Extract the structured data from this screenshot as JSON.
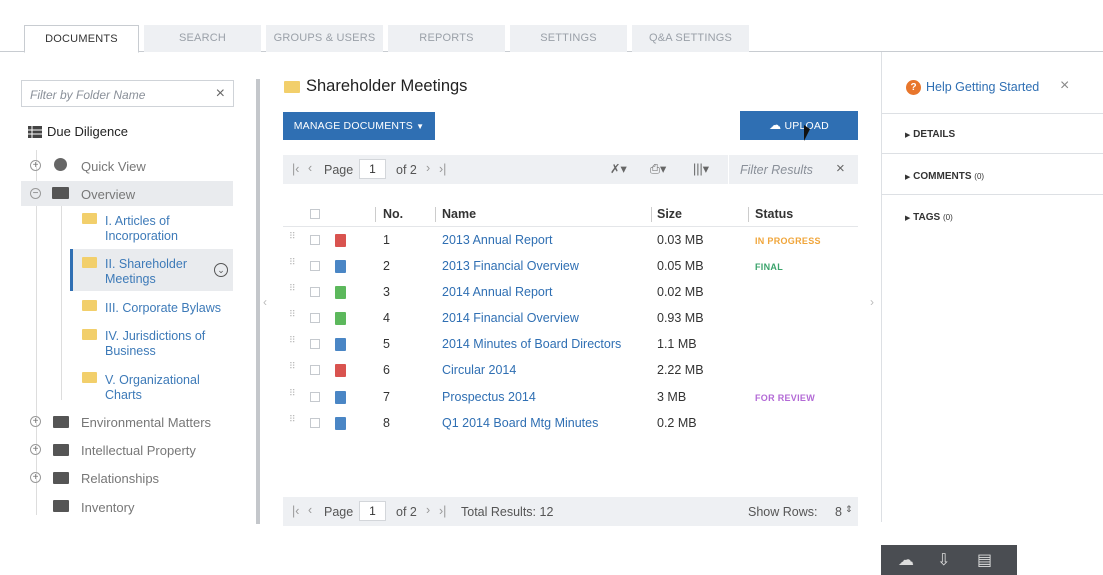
{
  "tabs": [
    "DOCUMENTS",
    "SEARCH",
    "GROUPS & USERS",
    "REPORTS",
    "SETTINGS",
    "Q&A SETTINGS"
  ],
  "sidebar": {
    "filter_placeholder": "Filter by Folder Name",
    "root_label": "Due Diligence",
    "items": [
      {
        "label": "Quick View"
      },
      {
        "label": "Overview"
      },
      {
        "label_lines": [
          "I. Articles of",
          "Incorporation"
        ]
      },
      {
        "label_lines": [
          "II. Shareholder",
          "Meetings"
        ]
      },
      {
        "label": "III. Corporate Bylaws"
      },
      {
        "label_lines": [
          "IV. Jurisdictions of",
          "Business"
        ]
      },
      {
        "label_lines": [
          "V. Organizational",
          "Charts"
        ]
      },
      {
        "label": "Environmental Matters"
      },
      {
        "label": "Intellectual Property"
      },
      {
        "label": "Relationships"
      },
      {
        "label": "Inventory"
      }
    ]
  },
  "main": {
    "title": "Shareholder Meetings",
    "manage_label": "MANAGE DOCUMENTS",
    "upload_label": "UPLOAD",
    "pager": {
      "page_label": "Page",
      "page_value": "1",
      "of_label": "of 2",
      "filter_placeholder": "Filter Results",
      "total": "Total Results: 12",
      "show_rows_label": "Show Rows:",
      "show_rows_value": "8"
    },
    "columns": [
      "No.",
      "Name",
      "Size",
      "Status"
    ],
    "rows": [
      {
        "no": "1",
        "name": "2013 Annual Report",
        "size": "0.03 MB",
        "status": "IN PROGRESS",
        "status_color": "#f0a53a",
        "icon_color": "#d9534f"
      },
      {
        "no": "2",
        "name": "2013 Financial Overview",
        "size": "0.05 MB",
        "status": "FINAL",
        "status_color": "#3aa36b",
        "icon_color": "#4a86c5"
      },
      {
        "no": "3",
        "name": "2014 Annual Report",
        "size": "0.02 MB",
        "status": "",
        "status_color": "#333",
        "icon_color": "#5cb85c"
      },
      {
        "no": "4",
        "name": "2014 Financial Overview",
        "size": "0.93 MB",
        "status": "",
        "status_color": "#333",
        "icon_color": "#5cb85c"
      },
      {
        "no": "5",
        "name": "2014 Minutes of Board Directors",
        "size": "1.1 MB",
        "status": "",
        "status_color": "#333",
        "icon_color": "#4a86c5"
      },
      {
        "no": "6",
        "name": "Circular 2014",
        "size": "2.22 MB",
        "status": "",
        "status_color": "#333",
        "icon_color": "#d9534f"
      },
      {
        "no": "7",
        "name": "Prospectus 2014",
        "size": "3 MB",
        "status": "FOR REVIEW",
        "status_color": "#b36ad6",
        "icon_color": "#4a86c5"
      },
      {
        "no": "8",
        "name": "Q1 2014 Board Mtg Minutes",
        "size": "0.2 MB",
        "status": "",
        "status_color": "#333",
        "icon_color": "#4a86c5"
      }
    ]
  },
  "right_panel": {
    "help_label": "Help Getting Started",
    "details_label": "DETAILS",
    "comments_label": "COMMENTS",
    "comments_count": "(0)",
    "tags_label": "TAGS",
    "tags_count": "(0)"
  },
  "colors": {
    "accent": "#2f6fb3",
    "link": "#2f6fb3",
    "help_icon": "#e8762c"
  }
}
